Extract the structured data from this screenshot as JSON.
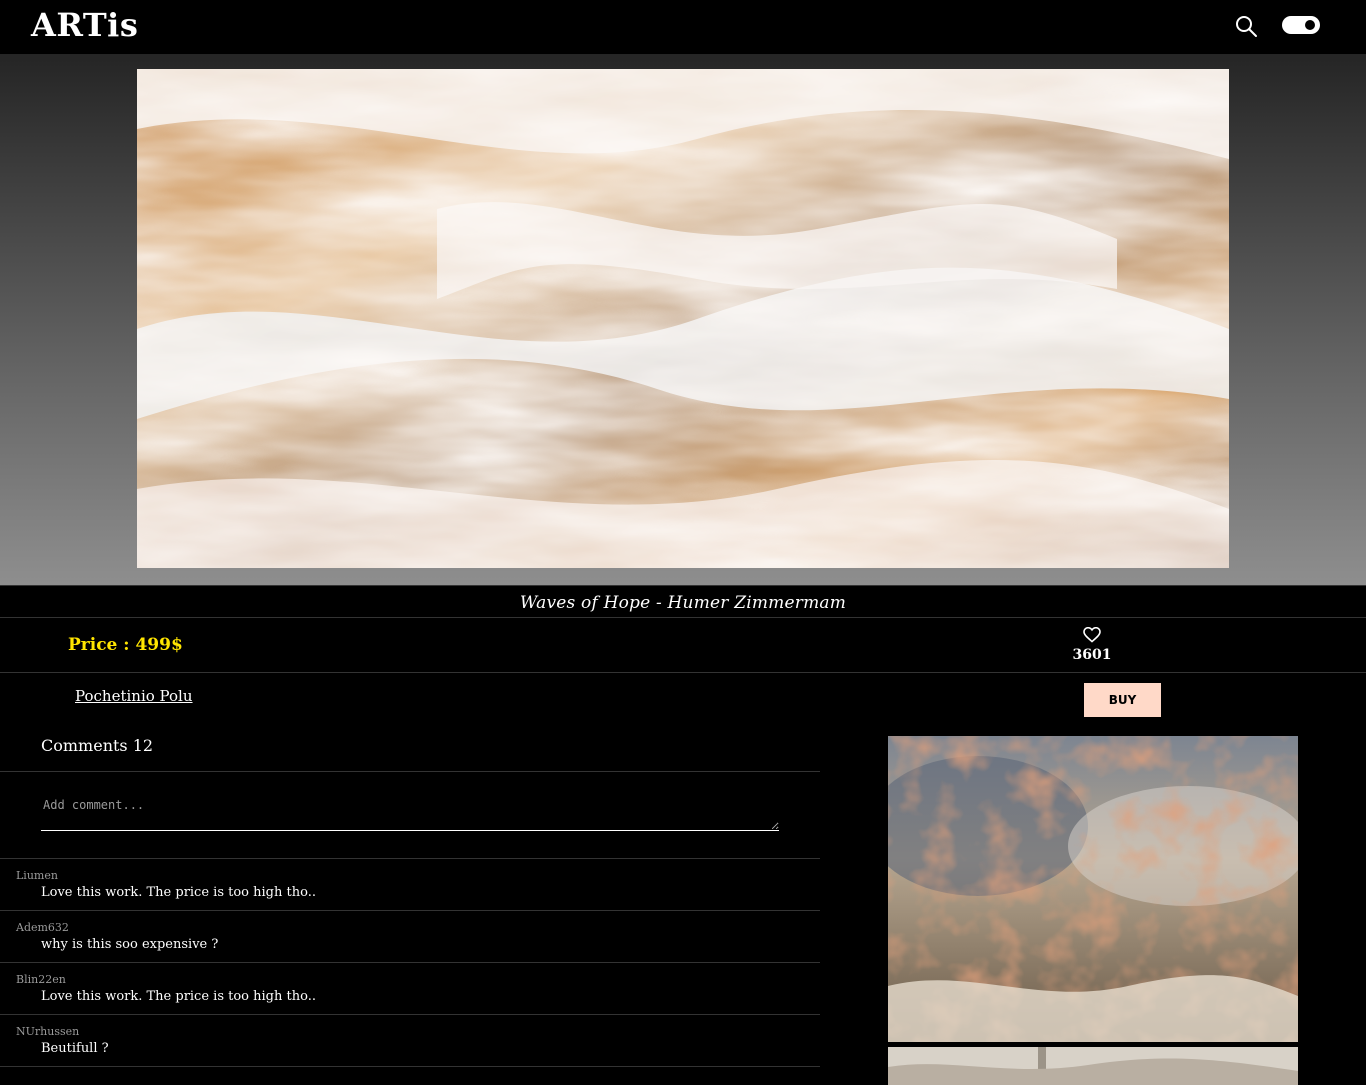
{
  "header": {
    "logo": "ARTis",
    "search_icon": "search-icon",
    "theme_toggle_icon": "theme-toggle-icon"
  },
  "artwork": {
    "title": "Waves of Hope - Humer Zimmermam",
    "price": "Price : 499$",
    "likes": "3601",
    "artist": "Pochetinio Polu",
    "buy_label": "BUY",
    "like_icon": "heart-icon"
  },
  "comments": {
    "heading": "Comments 12",
    "input_placeholder": "Add comment...",
    "items": [
      {
        "user": "Liumen",
        "text": "Love this work. The price is too high tho.."
      },
      {
        "user": "Adem632",
        "text": "why is this soo expensive ?"
      },
      {
        "user": "Blin22en",
        "text": "Love this work. The price is too high tho.."
      },
      {
        "user": "NUrhussen",
        "text": "Beutifull ?"
      }
    ]
  },
  "colors": {
    "price": "#ffe500",
    "buy_button": "#ffd9c8",
    "background": "#000000"
  }
}
